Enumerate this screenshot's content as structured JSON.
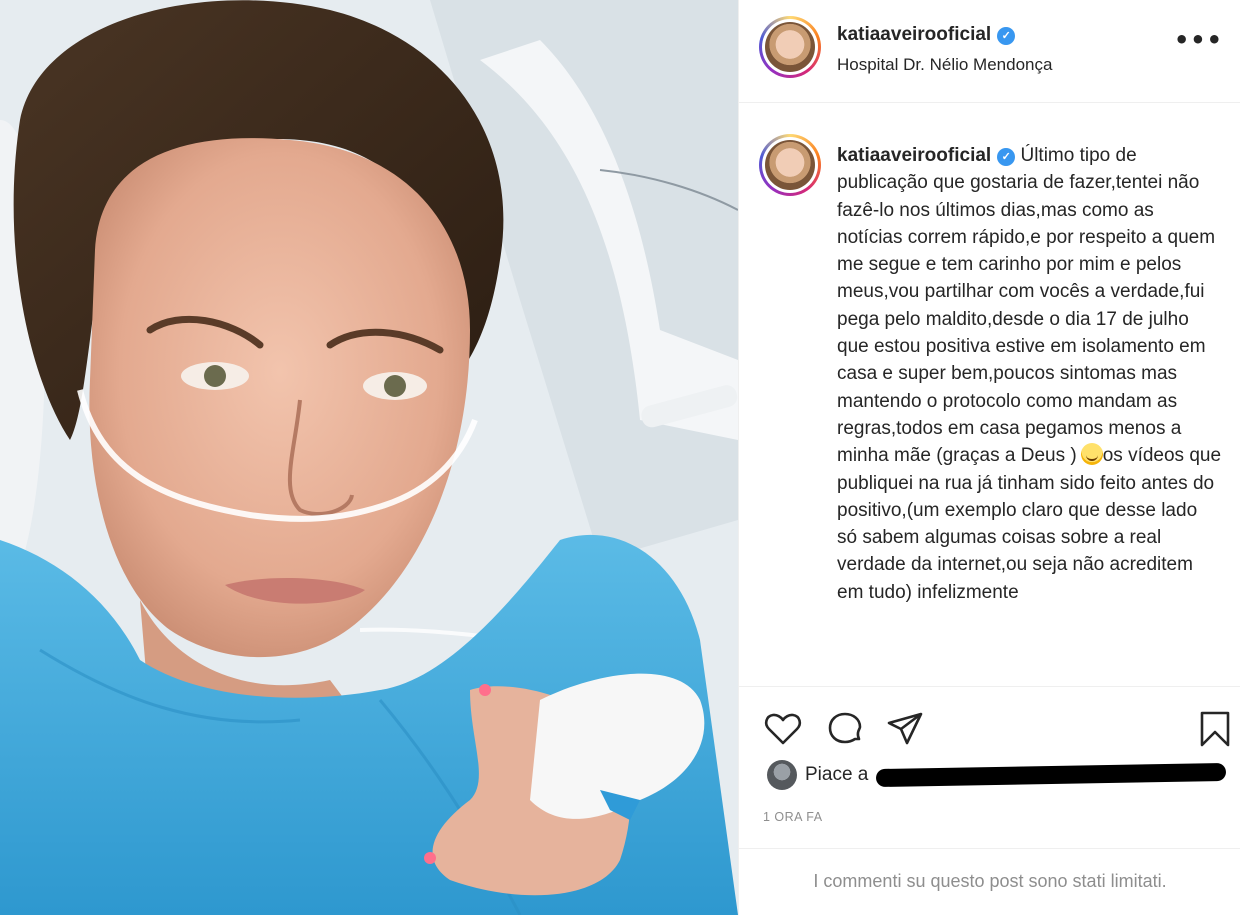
{
  "post": {
    "username": "katiaaveirooficial",
    "location": "Hospital Dr. Nélio Mendonça",
    "verified_glyph": "✓",
    "more_glyph": "•••",
    "caption_before_emoji": "Último tipo de publicação que gostaria de fazer,tentei não fazê-lo nos últimos dias,mas como as notícias correm rápido,e por respeito a quem me segue e tem carinho por mim e pelos meus,vou partilhar com vocês a verdade,fui pega pelo maldito,desde o dia 17 de julho que estou positiva estive em isolamento em casa e super bem,poucos sintomas mas mantendo o protocolo como mandam as regras,todos em casa pegamos menos a minha mãe (graças a Deus )",
    "caption_after_emoji": "os vídeos que publiquei na rua já tinham sido feito antes do positivo,(um exemplo claro que desse lado só sabem algumas coisas sobre a real verdade da internet,ou seja não acreditem em tudo) infelizmente",
    "likes_prefix": "Piace a",
    "timestamp": "1 ORA FA",
    "comments_notice": "I commenti su questo post sono stati limitati."
  },
  "icons": {
    "like": "heart-icon",
    "comment": "comment-icon",
    "share": "share-icon",
    "save": "bookmark-icon",
    "more": "more-options-icon",
    "verified": "verified-badge-icon"
  },
  "colors": {
    "gown": "#3fa7d6",
    "verified": "#3897f0",
    "muted_text": "#8e8e8e"
  }
}
